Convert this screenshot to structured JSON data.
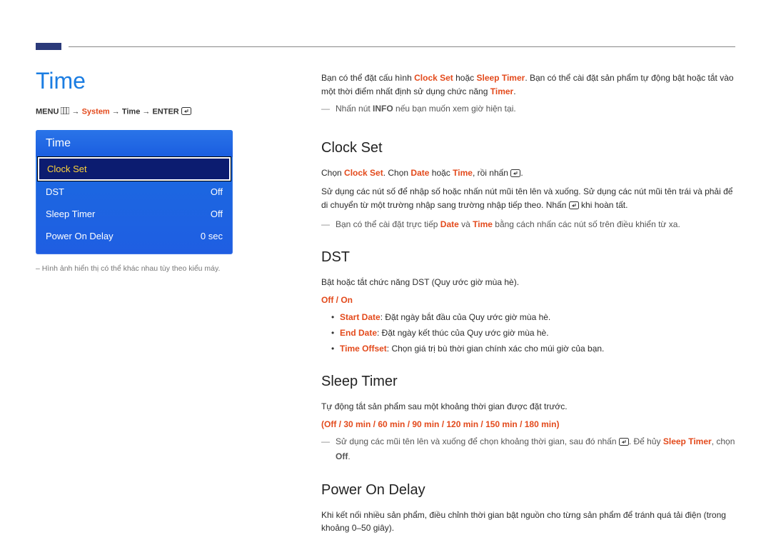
{
  "page_title": "Time",
  "breadcrumb": {
    "menu": "MENU",
    "system": "System",
    "time": "Time",
    "enter": "ENTER",
    "arrow": " → "
  },
  "menu": {
    "header": "Time",
    "items": [
      {
        "label": "Clock Set",
        "value": "",
        "selected": true
      },
      {
        "label": "DST",
        "value": "Off",
        "selected": false
      },
      {
        "label": "Sleep Timer",
        "value": "Off",
        "selected": false
      },
      {
        "label": "Power On Delay",
        "value": "0 sec",
        "selected": false
      }
    ]
  },
  "left_note": "Hình ảnh hiển thị có thể khác nhau tùy theo kiểu máy.",
  "intro": {
    "p1a": "Bạn có thể đặt cấu hình ",
    "p1b": "Clock Set",
    "p1c": " hoặc ",
    "p1d": "Sleep Timer",
    "p1e": ". Bạn có thể cài đặt sản phẩm tự động bật hoặc tắt vào một thời điểm nhất định sử dụng chức năng ",
    "p1f": "Timer",
    "p1g": ".",
    "tip_a": "Nhấn nút ",
    "tip_b": "INFO",
    "tip_c": " nếu bạn muốn xem giờ hiện tại."
  },
  "clockset": {
    "h": "Clock Set",
    "p1a": "Chọn ",
    "p1b": "Clock Set",
    "p1c": ". Chọn ",
    "p1d": "Date",
    "p1e": " hoặc ",
    "p1f": "Time",
    "p1g": ", rồi nhấn ",
    "p1h": ".",
    "p2": "Sử dụng các nút số để nhập số hoặc nhấn nút mũi tên lên và xuống. Sử dụng các nút mũi tên trái và phải để di chuyển từ một trường nhập sang trường nhập tiếp theo. Nhấn ",
    "p2b": " khi hoàn tất.",
    "tip_a": "Bạn có thể cài đặt trực tiếp ",
    "tip_b": "Date",
    "tip_c": " và ",
    "tip_d": "Time",
    "tip_e": " bằng cách nhấn các nút số trên điều khiển từ xa."
  },
  "dst": {
    "h": "DST",
    "p1": "Bật hoặc tắt chức năng DST (Quy ước giờ mùa hè).",
    "opts": "Off / On",
    "b1a": "Start Date",
    "b1b": ": Đặt ngày bắt đầu của Quy ước giờ mùa hè.",
    "b2a": "End Date",
    "b2b": ": Đặt ngày kết thúc của Quy ước giờ mùa hè.",
    "b3a": "Time Offset",
    "b3b": ": Chọn giá trị bù thời gian chính xác cho múi giờ của bạn."
  },
  "sleep": {
    "h": "Sleep Timer",
    "p1": "Tự động tắt sản phẩm sau một khoảng thời gian được đặt trước.",
    "opts": "(Off / 30 min / 60 min / 90 min / 120 min / 150 min / 180 min)",
    "tip_a": "Sử dụng các mũi tên lên và xuống để chọn khoảng thời gian, sau đó nhấn ",
    "tip_b": ". Để hủy ",
    "tip_c": "Sleep Timer",
    "tip_d": ", chọn ",
    "tip_e": "Off",
    "tip_f": "."
  },
  "power": {
    "h": "Power On Delay",
    "p1": "Khi kết nối nhiều sản phẩm, điều chỉnh thời gian bật nguồn cho từng sản phẩm để tránh quá tải điện (trong khoảng 0–50 giây)."
  }
}
